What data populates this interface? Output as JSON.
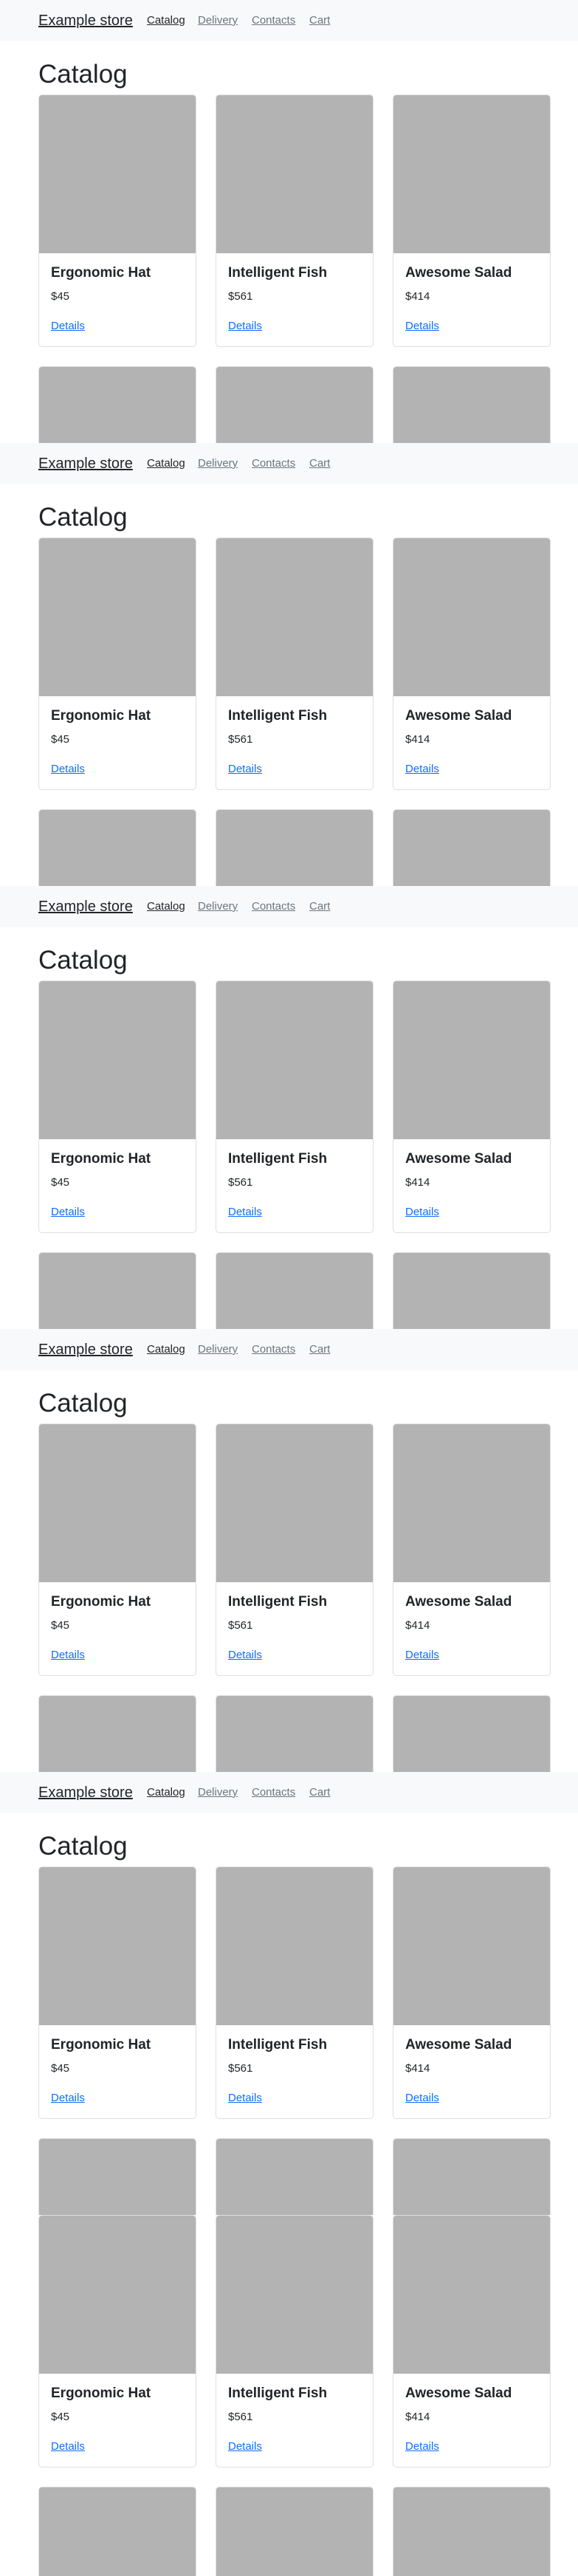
{
  "navbar": {
    "brand": "Example store",
    "links": [
      {
        "label": "Catalog",
        "active": true
      },
      {
        "label": "Delivery",
        "active": false
      },
      {
        "label": "Contacts",
        "active": false
      },
      {
        "label": "Cart",
        "active": false
      }
    ]
  },
  "page": {
    "title": "Catalog"
  },
  "products": [
    {
      "name": "Ergonomic Hat",
      "price": "$45",
      "link": "Details"
    },
    {
      "name": "Intelligent Fish",
      "price": "$561",
      "link": "Details"
    },
    {
      "name": "Awesome Salad",
      "price": "$414",
      "link": "Details"
    }
  ],
  "colors": {
    "navbar_bg": "#f8f9fa",
    "image_placeholder": "#b3b3b3",
    "link": "#0d6efd",
    "muted_nav": "#6c757d"
  }
}
